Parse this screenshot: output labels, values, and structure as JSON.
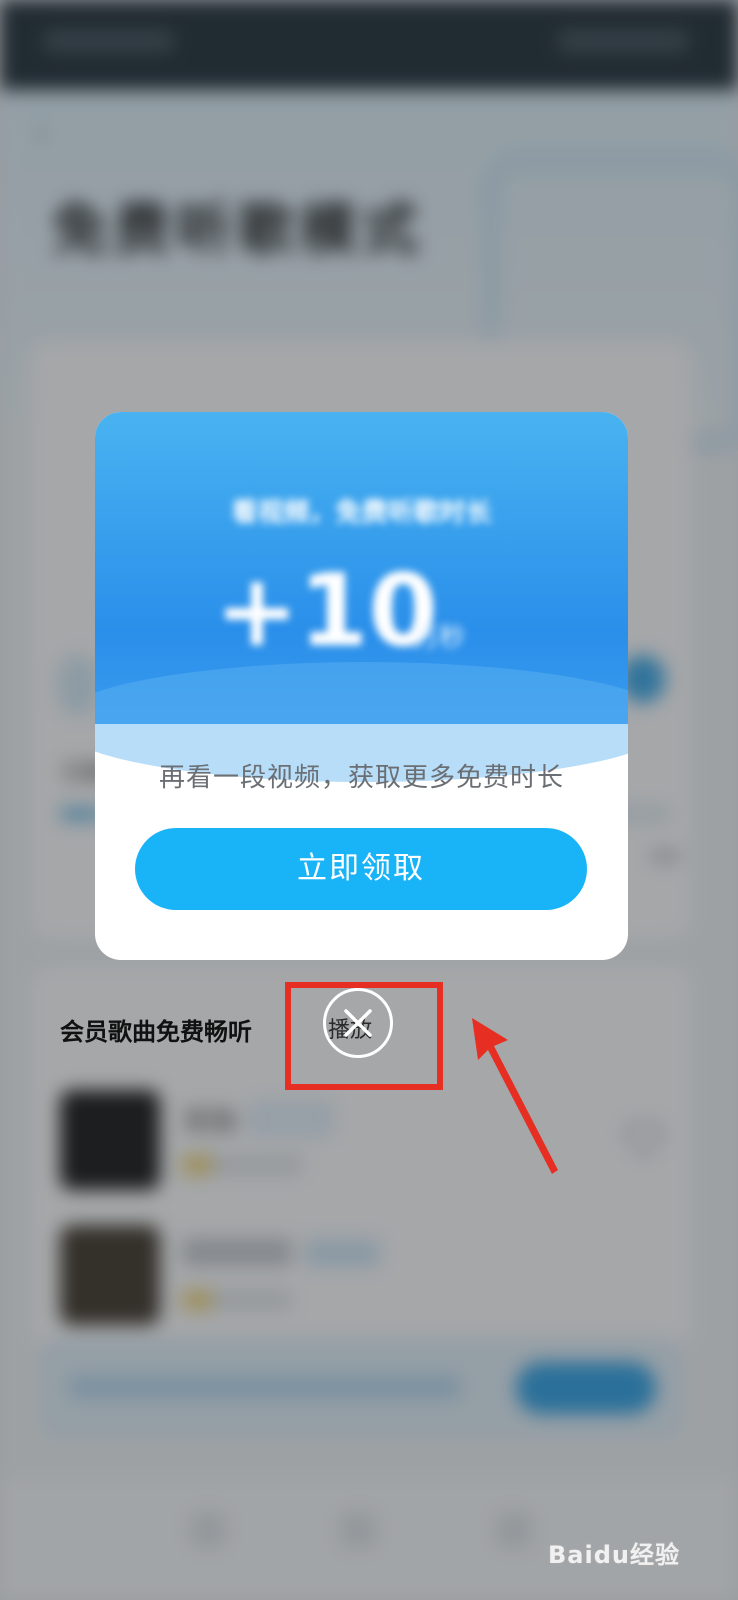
{
  "background": {
    "title": "免费听歌模式",
    "partial_text": "已做",
    "progress_count": "9次",
    "section_title": "会员歌曲免费畅听",
    "play_all_label": "播放",
    "songs": [
      {
        "title": "天际",
        "tag": "你搜索过"
      }
    ]
  },
  "modal": {
    "reward_line": "看视频，免费听歌时长",
    "reward_amount": "+10",
    "reward_unit": "万秒",
    "message": "再看一段视频，获取更多免费时长",
    "claim_button": "立即领取"
  },
  "watermark": "Baidu经验",
  "colors": {
    "primary_button": "#19b4f7",
    "highlight": "#e62f22",
    "modal_header": "#2a8fea"
  },
  "icons": {
    "close": "close-icon",
    "heart": "heart-icon",
    "back": "back-arrow-icon",
    "annotation_arrow": "arrow-icon"
  }
}
